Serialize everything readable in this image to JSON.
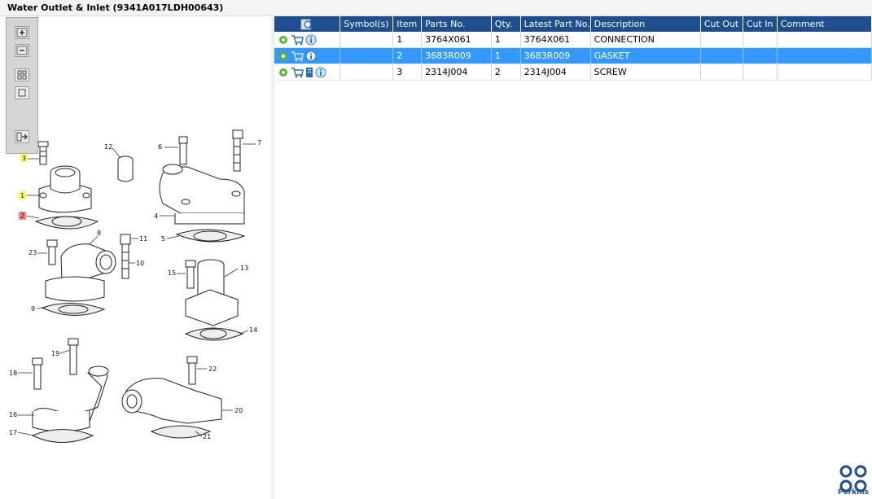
{
  "window": {
    "title": "Water Outlet & Inlet (9341A017LDH00643)"
  },
  "toolbar": {
    "buttons": [
      {
        "name": "zoom-in-button",
        "icon": "zoom-in-icon"
      },
      {
        "name": "zoom-out-button",
        "icon": "zoom-out-icon"
      },
      {
        "name": "fit-all-button",
        "icon": "fit-all-icon"
      },
      {
        "name": "actual-size-button",
        "icon": "actual-size-icon"
      },
      {
        "name": "hide-toolbar-button",
        "icon": "collapse-panel-icon"
      }
    ]
  },
  "diagram": {
    "callouts": [
      "3",
      "1",
      "2",
      "12",
      "6",
      "7",
      "4",
      "5",
      "8",
      "11",
      "23",
      "10",
      "9",
      "15",
      "13",
      "14",
      "19",
      "18",
      "22",
      "16",
      "20",
      "17",
      "21"
    ],
    "highlighted_callouts": {
      "3": "#ffff66",
      "1": "#ffff66",
      "2": "#ff8080"
    }
  },
  "table": {
    "columns": [
      "",
      "Symbol(s)",
      "Item",
      "Parts No.",
      "Qty.",
      "Latest Part No.",
      "Description",
      "Cut Out",
      "Cut In",
      "Comment"
    ],
    "rows": [
      {
        "item": "1",
        "part_no": "3764X061",
        "qty": "1",
        "latest_part_no": "3764X061",
        "description": "CONNECTION",
        "symbols": "",
        "cut_out": "",
        "cut_in": "",
        "comment": "",
        "icons": [
          "settings-icon",
          "cart-icon",
          "info-icon"
        ],
        "selected": false
      },
      {
        "item": "2",
        "part_no": "3683R009",
        "qty": "1",
        "latest_part_no": "3683R009",
        "description": "GASKET",
        "symbols": "",
        "cut_out": "",
        "cut_in": "",
        "comment": "",
        "icons": [
          "settings-icon",
          "cart-icon",
          "info-icon"
        ],
        "selected": true
      },
      {
        "item": "3",
        "part_no": "2314J004",
        "qty": "2",
        "latest_part_no": "2314J004",
        "description": "SCREW",
        "symbols": "",
        "cut_out": "",
        "cut_in": "",
        "comment": "",
        "icons": [
          "settings-icon",
          "cart-icon",
          "document-icon",
          "info-icon"
        ],
        "selected": false
      }
    ]
  },
  "brand": {
    "name": "Perkins",
    "color": "#1f4e8f"
  },
  "colors": {
    "header": "#1f4e8f",
    "selection": "#3399ff"
  }
}
